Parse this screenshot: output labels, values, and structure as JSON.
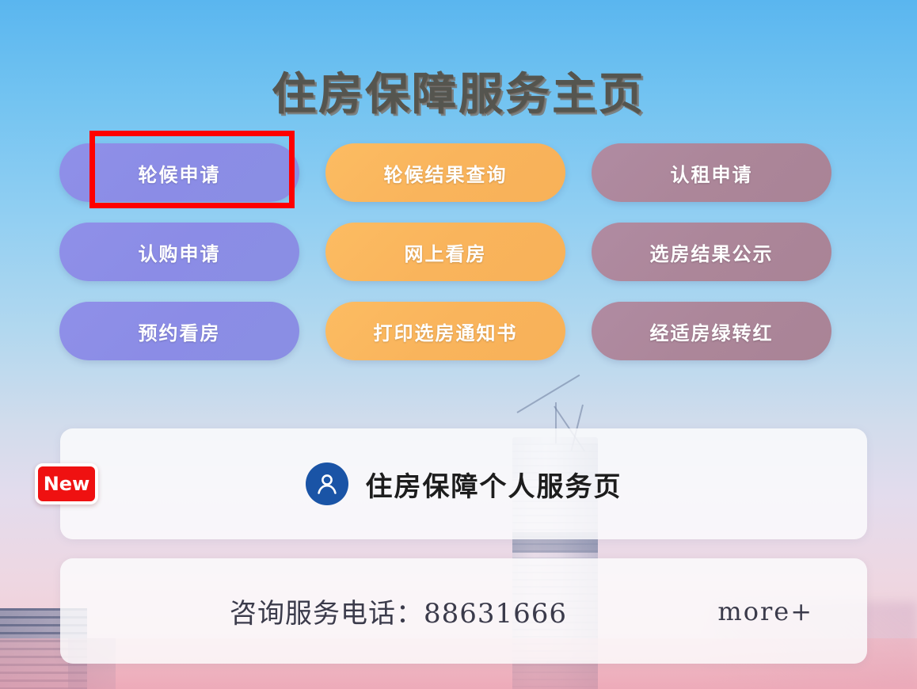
{
  "header": {
    "title": "住房保障服务主页"
  },
  "service_grid": {
    "rows": [
      [
        {
          "label": "轮候申请",
          "style": "purple",
          "highlighted": true
        },
        {
          "label": "轮候结果查询",
          "style": "orange",
          "highlighted": false
        },
        {
          "label": "认租申请",
          "style": "mauve",
          "highlighted": false
        }
      ],
      [
        {
          "label": "认购申请",
          "style": "purple",
          "highlighted": false
        },
        {
          "label": "网上看房",
          "style": "orange",
          "highlighted": false
        },
        {
          "label": "选房结果公示",
          "style": "mauve",
          "highlighted": false
        }
      ],
      [
        {
          "label": "预约看房",
          "style": "purple",
          "highlighted": false
        },
        {
          "label": "打印选房通知书",
          "style": "orange",
          "highlighted": false
        },
        {
          "label": "经适房绿转红",
          "style": "mauve",
          "highlighted": false
        }
      ]
    ]
  },
  "personal_card": {
    "badge": "New",
    "icon": "user-avatar-icon",
    "label": "住房保障个人服务页"
  },
  "phone_card": {
    "text": "咨询服务电话：88631666",
    "phone_number": "88631666",
    "more_label": "more+"
  },
  "annotation": {
    "type": "red-rectangle-highlight",
    "target": "轮候申请",
    "color": "#ff0000"
  },
  "colors": {
    "purple_pill": "#8b8ce6",
    "orange_pill": "#f9b45c",
    "mauve_pill": "#ac8699",
    "badge_red": "#ef1111",
    "avatar_blue": "#1a54a6",
    "title_text": "#55554f",
    "background_top": "#5ab6ef",
    "background_bottom": "#f0c4cf"
  }
}
